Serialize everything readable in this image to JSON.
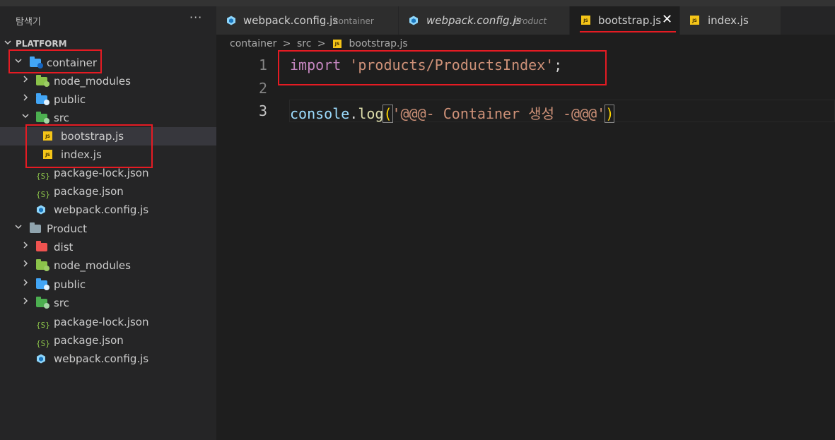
{
  "sidebar": {
    "title": "탐색기",
    "more_icon": "···",
    "section_label": "PLATFORM",
    "tree": [
      {
        "label": "container",
        "kind": "folder-open",
        "depth": 0,
        "icon": "folder-container-icon"
      },
      {
        "label": "node_modules",
        "kind": "folder",
        "depth": 1,
        "icon": "folder-node-icon"
      },
      {
        "label": "public",
        "kind": "folder",
        "depth": 1,
        "icon": "folder-public-icon"
      },
      {
        "label": "src",
        "kind": "folder-open",
        "depth": 1,
        "icon": "folder-src-icon"
      },
      {
        "label": "bootstrap.js",
        "kind": "file",
        "depth": 2,
        "icon": "js-file-icon"
      },
      {
        "label": "index.js",
        "kind": "file",
        "depth": 2,
        "icon": "js-file-icon"
      },
      {
        "label": "package-lock.json",
        "kind": "file",
        "depth": 1,
        "icon": "json-file-icon"
      },
      {
        "label": "package.json",
        "kind": "file",
        "depth": 1,
        "icon": "json-file-icon"
      },
      {
        "label": "webpack.config.js",
        "kind": "file",
        "depth": 1,
        "icon": "webpack-icon"
      },
      {
        "label": "Product",
        "kind": "folder-open",
        "depth": 0,
        "icon": "folder-icon"
      },
      {
        "label": "dist",
        "kind": "folder",
        "depth": 1,
        "icon": "folder-dist-icon"
      },
      {
        "label": "node_modules",
        "kind": "folder",
        "depth": 1,
        "icon": "folder-node-icon"
      },
      {
        "label": "public",
        "kind": "folder",
        "depth": 1,
        "icon": "folder-public-icon"
      },
      {
        "label": "src",
        "kind": "folder",
        "depth": 1,
        "icon": "folder-src-icon"
      },
      {
        "label": "package-lock.json",
        "kind": "file",
        "depth": 1,
        "icon": "json-file-icon"
      },
      {
        "label": "package.json",
        "kind": "file",
        "depth": 1,
        "icon": "json-file-icon"
      },
      {
        "label": "webpack.config.js",
        "kind": "file",
        "depth": 1,
        "icon": "webpack-icon"
      }
    ]
  },
  "tabs": [
    {
      "label": "webpack.config.js",
      "description": "container",
      "icon": "webpack-icon",
      "active": false,
      "italic": false
    },
    {
      "label": "webpack.config.js",
      "description": "Product",
      "icon": "webpack-icon",
      "active": false,
      "italic": true
    },
    {
      "label": "bootstrap.js",
      "description": "",
      "icon": "js-file-icon",
      "active": true,
      "italic": false,
      "close": "✕"
    },
    {
      "label": "index.js",
      "description": "",
      "icon": "js-file-icon",
      "active": false,
      "italic": false
    }
  ],
  "breadcrumb": {
    "items": [
      "container",
      "src",
      "bootstrap.js"
    ],
    "separator": ">"
  },
  "editor": {
    "line_numbers": [
      "1",
      "2",
      "3"
    ],
    "line1": {
      "keyword": "import",
      "space": " ",
      "string": "'products/ProductsIndex'",
      "end": ";"
    },
    "line3": {
      "object": "console",
      "dot": ".",
      "method": "log",
      "open": "(",
      "string": "'@@@- Container 생성 -@@@'",
      "close": ")"
    }
  },
  "colors": {
    "annotation": "#e51b23",
    "js": "#f5c518",
    "keyword": "#c586c0",
    "string": "#ce9178",
    "variable": "#9cdcfe",
    "function": "#dcdcaa"
  }
}
